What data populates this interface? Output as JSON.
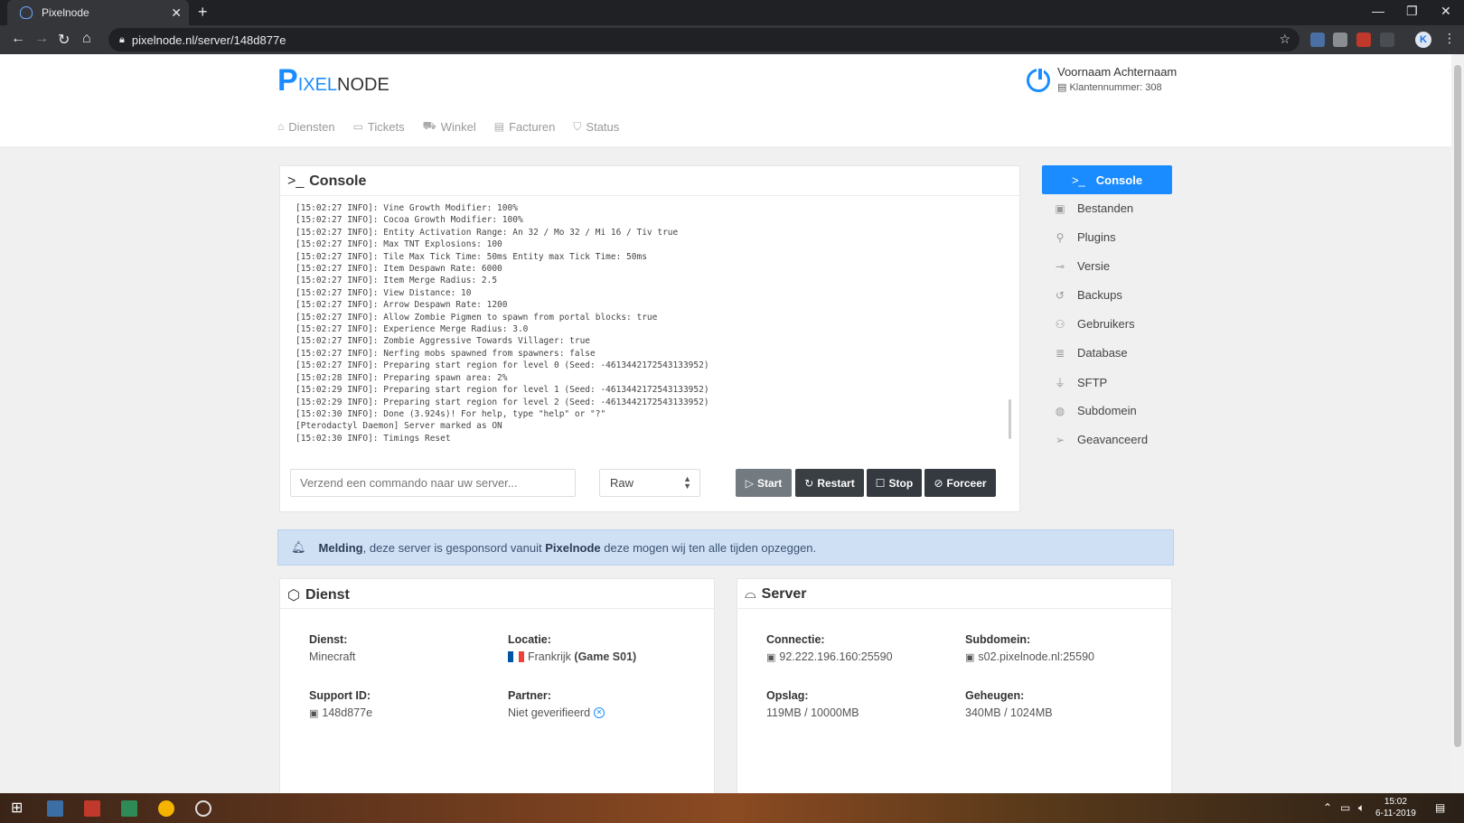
{
  "browser": {
    "tab_title": "Pixelnode",
    "url": "pixelnode.nl/server/148d877e"
  },
  "header": {
    "logo_p": "P",
    "logo_ixel": "IXEL",
    "logo_node": "NODE",
    "user_name": "Voornaam Achternaam",
    "customer_number": "Klantennummer: 308",
    "nav": [
      "Diensten",
      "Tickets",
      "Winkel",
      "Facturen",
      "Status"
    ]
  },
  "console": {
    "title": "Console",
    "lines": [
      "[15:02:27 INFO]: Vine Growth Modifier: 100%",
      "[15:02:27 INFO]: Cocoa Growth Modifier: 100%",
      "[15:02:27 INFO]: Entity Activation Range: An 32 / Mo 32 / Mi 16 / Tiv true",
      "[15:02:27 INFO]: Max TNT Explosions: 100",
      "[15:02:27 INFO]: Tile Max Tick Time: 50ms Entity max Tick Time: 50ms",
      "[15:02:27 INFO]: Item Despawn Rate: 6000",
      "[15:02:27 INFO]: Item Merge Radius: 2.5",
      "[15:02:27 INFO]: View Distance: 10",
      "[15:02:27 INFO]: Arrow Despawn Rate: 1200",
      "[15:02:27 INFO]: Allow Zombie Pigmen to spawn from portal blocks: true",
      "[15:02:27 INFO]: Experience Merge Radius: 3.0",
      "[15:02:27 INFO]: Zombie Aggressive Towards Villager: true",
      "[15:02:27 INFO]: Nerfing mobs spawned from spawners: false",
      "[15:02:27 INFO]: Preparing start region for level 0 (Seed: -4613442172543133952)",
      "[15:02:28 INFO]: Preparing spawn area: 2%",
      "[15:02:29 INFO]: Preparing start region for level 1 (Seed: -4613442172543133952)",
      "[15:02:29 INFO]: Preparing start region for level 2 (Seed: -4613442172543133952)",
      "[15:02:30 INFO]: Done (3.924s)! For help, type \"help\" or \"?\"",
      "[Pterodactyl Daemon] Server marked as ON",
      "[15:02:30 INFO]: Timings Reset"
    ],
    "input_placeholder": "Verzend een commando naar uw server...",
    "select_value": "Raw",
    "btn_start": "Start",
    "btn_restart": "Restart",
    "btn_stop": "Stop",
    "btn_force": "Forceer"
  },
  "sidebar": {
    "active": "Console",
    "items": [
      "Bestanden",
      "Plugins",
      "Versie",
      "Backups",
      "Gebruikers",
      "Database",
      "SFTP",
      "Subdomein",
      "Geavanceerd"
    ]
  },
  "alert": {
    "bold1": "Melding",
    "text1": ", deze server is gesponsord vanuit ",
    "bold2": "Pixelnode",
    "text2": " deze mogen wij ten alle tijden opzeggen."
  },
  "dienst": {
    "title": "Dienst",
    "dienst_label": "Dienst:",
    "dienst_value": "Minecraft",
    "locatie_label": "Locatie:",
    "locatie_value": "Frankrijk",
    "locatie_extra": "(Game S01)",
    "support_label": "Support ID:",
    "support_value": "148d877e",
    "partner_label": "Partner:",
    "partner_value": "Niet geverifieerd"
  },
  "server": {
    "title": "Server",
    "connectie_label": "Connectie:",
    "connectie_value": "92.222.196.160:25590",
    "subdomein_label": "Subdomein:",
    "subdomein_value": "s02.pixelnode.nl:25590",
    "opslag_label": "Opslag:",
    "opslag_value": "119MB / 10000MB",
    "geheugen_label": "Geheugen:",
    "geheugen_value": "340MB / 1024MB"
  },
  "taskbar": {
    "time": "15:02",
    "date": "6-11-2019"
  }
}
